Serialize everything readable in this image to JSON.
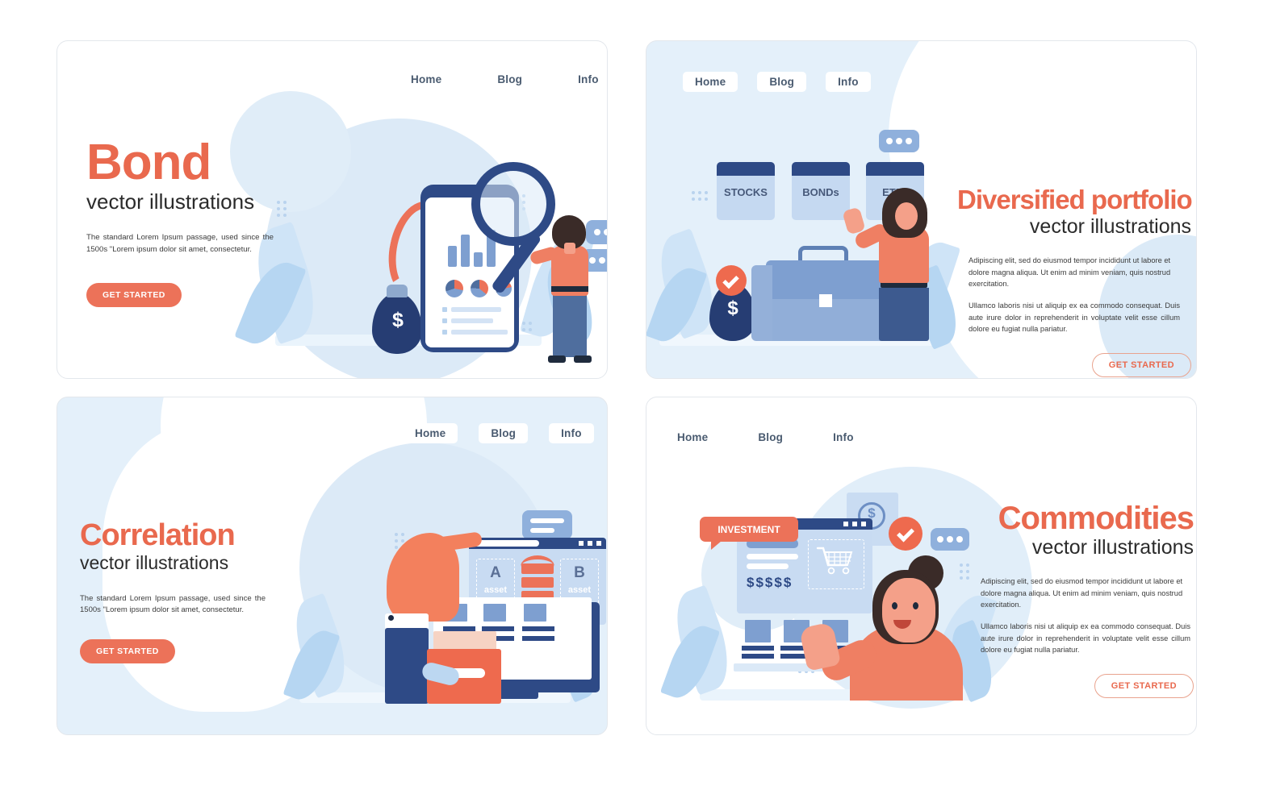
{
  "meta": {
    "nav_labels": [
      "Home",
      "Blog",
      "Info"
    ],
    "subtitle": "vector illustrations",
    "cta_label": "GET STARTED",
    "colors": {
      "accent_orange": "#e9694e",
      "button_orange": "#ec7259",
      "deep_navy": "#2e4a86",
      "panel_tint": "#e4f0fa",
      "blob_blue": "#dceaf7",
      "nav_text": "#4a5b70"
    }
  },
  "panels": [
    {
      "id": "panel-1",
      "title": "Bond",
      "subtitle": "vector illustrations",
      "body": "The standard Lorem Ipsum passage, used since the 1500s \"Lorem ipsum dolor sit amet, consectetur.",
      "cta": "GET STARTED",
      "cta_style": "solid",
      "nav": [
        "Home",
        "Blog",
        "Info"
      ],
      "nav_style": "plain",
      "background": "white",
      "illustration": {
        "name": "bond-phone-magnifier",
        "money_symbol": "$",
        "elements": [
          "money-bag",
          "smartphone",
          "bar-chart",
          "pie-charts",
          "magnifier",
          "woman",
          "chat-bubbles",
          "up-arrow"
        ]
      }
    },
    {
      "id": "panel-2",
      "title": "Diversified portfolio",
      "subtitle": "vector illustrations",
      "body_1": "Adipiscing elit, sed do eiusmod tempor incididunt ut labore et dolore magna aliqua. Ut enim ad minim veniam, quis nostrud exercitation.",
      "body_2": "Ullamco laboris nisi ut aliquip ex ea commodo consequat. Duis aute irure dolor in reprehenderit in voluptate velit esse cillum dolore eu fugiat nulla pariatur.",
      "cta": "GET STARTED",
      "cta_style": "outline",
      "nav": [
        "Home",
        "Blog",
        "Info"
      ],
      "nav_style": "pill",
      "background": "tint",
      "illustration": {
        "name": "portfolio-briefcase",
        "cards": [
          "STOCKS",
          "BONDs",
          "ETFs"
        ],
        "money_symbol": "$",
        "elements": [
          "money-bag",
          "briefcase",
          "checkmark",
          "woman",
          "chat-bubble"
        ]
      }
    },
    {
      "id": "panel-3",
      "title": "Correlation",
      "subtitle": "vector illustrations",
      "body": "The standard Lorem Ipsum passage, used since the 1500s \"Lorem ipsum dolor sit amet, consectetur.",
      "cta": "GET STARTED",
      "cta_style": "solid",
      "nav": [
        "Home",
        "Blog",
        "Info"
      ],
      "nav_style": "pill",
      "background": "tint",
      "illustration": {
        "name": "correlation-assets",
        "asset_a_letter": "A",
        "asset_a_label": "asset",
        "asset_b_letter": "B",
        "asset_b_label": "asset",
        "elements": [
          "hand",
          "browser-window",
          "monitor",
          "folder",
          "chat-bubble",
          "swap-arrows"
        ]
      }
    },
    {
      "id": "panel-4",
      "title": "Commodities",
      "subtitle": "vector illustrations",
      "body_1": "Adipiscing elit, sed do eiusmod tempor incididunt ut labore et dolore magna aliqua. Ut enim ad minim veniam, quis nostrud exercitation.",
      "body_2": "Ullamco laboris nisi ut aliquip ex ea commodo consequat. Duis aute irure dolor in reprehenderit in voluptate velit esse cillum dolore eu fugiat nulla pariatur.",
      "cta": "GET STARTED",
      "cta_style": "outline",
      "nav": [
        "Home",
        "Blog",
        "Info"
      ],
      "nav_style": "plain",
      "background": "white",
      "illustration": {
        "name": "commodities-shopping",
        "ribbon_label": "INVESTMENT",
        "price_row": "$$$$$",
        "money_symbol": "$",
        "elements": [
          "browser-window",
          "shopping-cart",
          "checkmark",
          "chat-bubble",
          "woman",
          "coin"
        ]
      }
    }
  ]
}
